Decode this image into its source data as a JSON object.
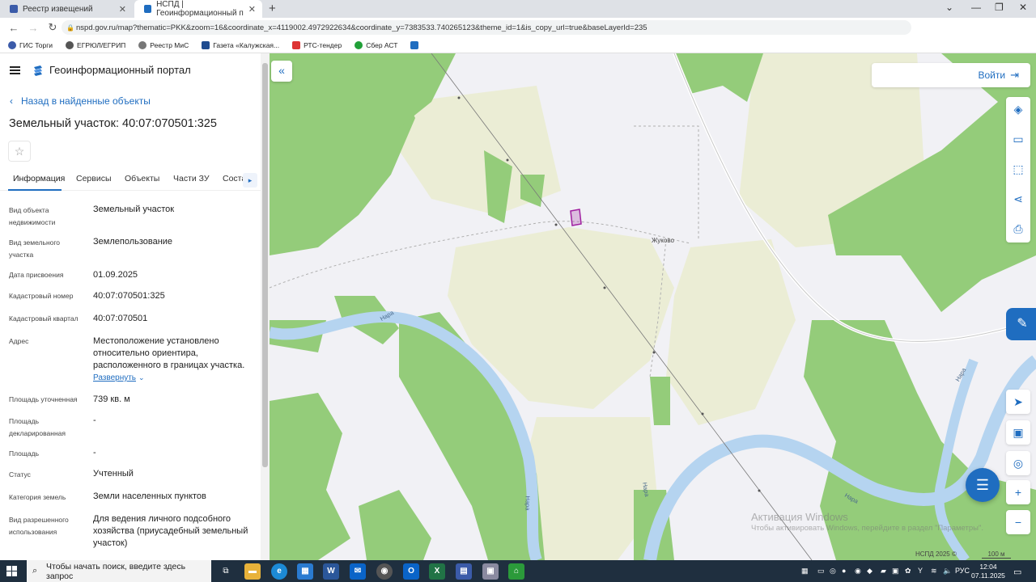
{
  "browser": {
    "tabs": [
      {
        "label": "Реестр извещений",
        "active": false
      },
      {
        "label": "НСПД | Геоинформационный п",
        "active": true
      }
    ],
    "url": "nspd.gov.ru/map?thematic=PKK&zoom=16&coordinate_x=4119002.4972922634&coordinate_y=7383533.740265123&theme_id=1&is_copy_url=true&baseLayerId=235",
    "bookmarks": [
      "ГИС Торги",
      "ЕГРЮЛ/ЕГРИП",
      "Реестр МиС",
      "Газета «Калужская...",
      "РТС-тендер",
      "Сбер АСТ"
    ]
  },
  "portal": {
    "title": "Геоинформационный портал",
    "back_label": "Назад в найденные объекты",
    "object_title": "Земельный участок: 40:07:070501:325",
    "tabs": [
      "Информация",
      "Сервисы",
      "Объекты",
      "Части ЗУ",
      "Соста"
    ],
    "expand_label": "Развернуть",
    "fields": [
      {
        "label": "Вид объекта недвижимости",
        "value": "Земельный участок"
      },
      {
        "label": "Вид земельного участка",
        "value": "Землепользование"
      },
      {
        "label": "Дата присвоения",
        "value": "01.09.2025"
      },
      {
        "label": "Кадастровый номер",
        "value": "40:07:070501:325"
      },
      {
        "label": "Кадастровый квартал",
        "value": "40:07:070501"
      },
      {
        "label": "Адрес",
        "value": "Местоположение установлено относительно ориентира, расположенного в границах участка."
      },
      {
        "label": "Площадь уточненная",
        "value": "739 кв. м"
      },
      {
        "label": "Площадь декларированная",
        "value": "-"
      },
      {
        "label": "Площадь",
        "value": "-"
      },
      {
        "label": "Статус",
        "value": "Учтенный"
      },
      {
        "label": "Категория земель",
        "value": "Земли населенных пунктов"
      },
      {
        "label": "Вид разрешенного использования",
        "value": "Для ведения личного подсобного хозяйства (приусадебный земельный участок)"
      }
    ]
  },
  "map": {
    "login_label": "Войти",
    "village_label": "Жуково",
    "river_labels": [
      "Нара",
      "Нара",
      "Нара",
      "Нара",
      "Нара"
    ],
    "watermark_title": "Активация Windows",
    "watermark_text": "Чтобы активировать Windows, перейдите в раздел \"Параметры\".",
    "copyright": "НСПД 2025 ©",
    "scale": "100 м",
    "colors": {
      "forest": "#94cc7a",
      "field": "#ebedd5",
      "water": "#b5d4f0",
      "parcel": "#a020a0",
      "accent": "#1f6dc0"
    }
  },
  "taskbar": {
    "search_placeholder": "Чтобы начать поиск, введите здесь запрос",
    "lang": "РУС",
    "time": "12:04",
    "date": "07.11.2025"
  }
}
